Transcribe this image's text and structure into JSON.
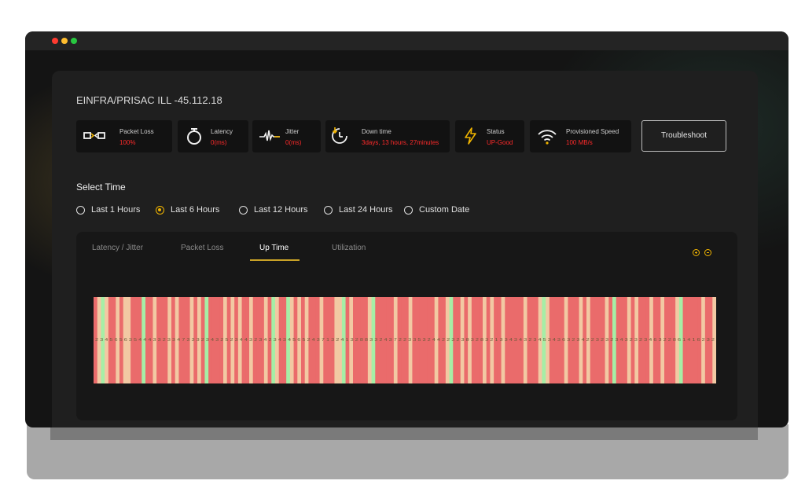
{
  "device": {
    "title": "EINFRA/PRISAC ILL -45.112.18"
  },
  "metrics": [
    {
      "icon": "packet-loss-icon",
      "label": "Packet Loss",
      "value": "100%"
    },
    {
      "icon": "stopwatch-icon",
      "label": "Latency",
      "value": "0(ms)"
    },
    {
      "icon": "pulse-icon",
      "label": "Jitter",
      "value": "0(ms)"
    },
    {
      "icon": "clock-down-icon",
      "label": "Down time",
      "value": "3days, 13 hours, 27minutes"
    },
    {
      "icon": "lightning-icon",
      "label": "Status",
      "value": "UP-Good"
    },
    {
      "icon": "wifi-icon",
      "label": "Provisioned Speed",
      "value": "100 MB/s"
    }
  ],
  "troubleshoot_label": "Troubleshoot",
  "select_time": {
    "heading": "Select Time",
    "options": [
      "Last 1 Hours",
      "Last 6 Hours",
      "Last 12 Hours",
      "Last 24 Hours",
      "Custom Date"
    ],
    "selected": "Last 6 Hours"
  },
  "tabs": {
    "items": [
      "Latency / Jitter",
      "Packet Loss",
      "Up Time",
      "Utilization"
    ],
    "active": "Up Time"
  },
  "zoom": {
    "in_icon": "zoom-in-icon",
    "out_icon": "zoom-out-icon"
  },
  "colors": {
    "accent": "#f0b400",
    "down": "#ea6b6b",
    "up": "#f2c9a3",
    "up_strong": "#a6eea6",
    "value_red": "#ff2a2a"
  },
  "chart_data": {
    "type": "heatmap",
    "description_labels": "up/down status strips over the selected time range",
    "states": [
      "down",
      "up",
      "down",
      "up",
      "down",
      "down",
      "up",
      "down",
      "up",
      "up",
      "down",
      "down",
      "down",
      "up",
      "down",
      "down",
      "up",
      "down",
      "down",
      "down",
      "up",
      "down",
      "up",
      "down",
      "down",
      "down",
      "up",
      "down",
      "up",
      "down",
      "up",
      "down",
      "down",
      "down",
      "down",
      "up",
      "down",
      "up",
      "down",
      "up",
      "down",
      "down",
      "up",
      "down",
      "down",
      "down",
      "up",
      "down",
      "down",
      "up",
      "down",
      "down",
      "down",
      "up",
      "down",
      "up",
      "down",
      "up",
      "down",
      "down",
      "down",
      "up",
      "down",
      "down",
      "down",
      "up",
      "up",
      "down",
      "down",
      "up",
      "down",
      "down",
      "down",
      "down",
      "up",
      "down",
      "down",
      "down",
      "down",
      "down",
      "down",
      "up",
      "down",
      "down",
      "down",
      "up",
      "down",
      "down",
      "down",
      "down",
      "down",
      "down",
      "up",
      "down",
      "down",
      "up",
      "down",
      "down",
      "down",
      "up",
      "down",
      "up",
      "down",
      "down",
      "down",
      "up",
      "down",
      "up",
      "down",
      "down",
      "up",
      "down",
      "down",
      "down",
      "down",
      "down",
      "up",
      "down",
      "down",
      "down",
      "up",
      "down",
      "up",
      "down",
      "down",
      "down",
      "down",
      "up",
      "down",
      "down",
      "down",
      "up",
      "down",
      "up",
      "down",
      "down",
      "down",
      "down",
      "up",
      "down",
      "up",
      "down",
      "down",
      "down",
      "up",
      "down",
      "up",
      "down",
      "down",
      "down",
      "up",
      "down",
      "down",
      "up",
      "down",
      "down",
      "down",
      "up",
      "down",
      "down",
      "down",
      "down",
      "down",
      "down",
      "up",
      "down",
      "down",
      "up"
    ],
    "strong_up_indices": [
      2,
      13,
      30,
      48,
      52,
      67,
      75,
      96,
      121,
      140,
      158
    ],
    "labels_row": "2 3 4 5 6 5 6 3 5 4 4 4 3 3 2 3 3 4 7 3 3 3 2 3 4 3 2 5 2 3 4 4 3 2 3 4 2 3 4 3 4 5 6 5 2 4 3 7 1 3 2 4 1 3 2 8 8 3 3 2 4 3 7 2 2 3 3 5 3 2 4 4 2 2 3 2 3 8 3 2 8 3 2 1 3 3 4 3 4 3 2 3 4 5 3 4 3 6 3 2 3 4 2 2 3 2 3 2 3 4 3 2 3 2 3 4 6 3 2 2 8 6 1 4 1 6 2 3 2"
  }
}
